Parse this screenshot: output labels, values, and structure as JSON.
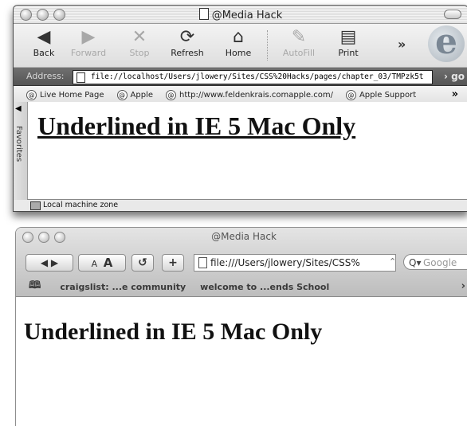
{
  "ie": {
    "title": "@Media Hack",
    "toolbar": {
      "back": "Back",
      "forward": "Forward",
      "stop": "Stop",
      "refresh": "Refresh",
      "home": "Home",
      "autofill": "AutoFill",
      "print": "Print",
      "more": "»"
    },
    "address": {
      "label": "Address:",
      "value": "file://localhost/Users/jlowery/Sites/CSS%20Hacks/pages/chapter_03/TMPzk5t",
      "go": "› go"
    },
    "favorites_bar": [
      "Live Home Page",
      "Apple",
      "http://www.feldenkrais.comapple.com/",
      "Apple Support"
    ],
    "favorites_more": "»",
    "sidebar_tab": "Favorites",
    "heading": "Underlined in IE 5 Mac Only",
    "status": "Local machine zone"
  },
  "safari": {
    "title": "@Media Hack",
    "url": "file:///Users/jlowery/Sites/CSS%",
    "search_placeholder": "Google",
    "text_small": "A",
    "text_large": "A",
    "reload": "↺",
    "add": "+",
    "bookmarks": [
      "craigslist: ...e community",
      "welcome to ...ends School"
    ],
    "bookmarks_more": "›",
    "heading": "Underlined in IE 5 Mac Only"
  }
}
